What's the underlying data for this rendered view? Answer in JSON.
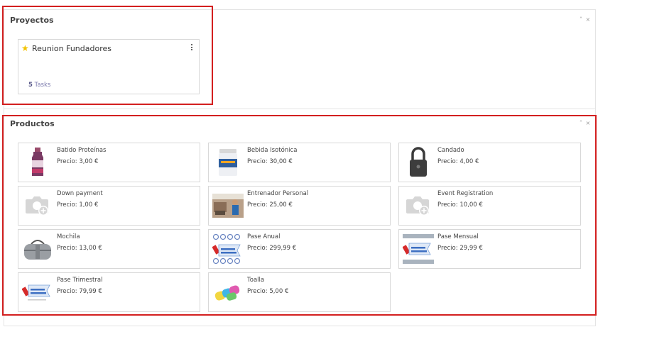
{
  "proyectos": {
    "title": "Proyectos",
    "controls": "˄ ×",
    "card": {
      "name": "Reunion Fundadores",
      "task_count": "5",
      "tasks_label": "Tasks"
    }
  },
  "productos": {
    "title": "Productos",
    "controls": "˄ ×",
    "items": [
      {
        "name": "Batido Proteínas",
        "price": "Precio: 3,00 €",
        "image": "protein-shake-bottle"
      },
      {
        "name": "Bebida Isotónica",
        "price": "Precio: 30,00 €",
        "image": "isotonic-drink-tub"
      },
      {
        "name": "Candado",
        "price": "Precio: 4,00 €",
        "image": "padlock"
      },
      {
        "name": "Down payment",
        "price": "Precio: 1,00 €",
        "image": "camera-placeholder"
      },
      {
        "name": "Entrenador Personal",
        "price": "Precio: 25,00 €",
        "image": "gym-trainer-photo"
      },
      {
        "name": "Event Registration",
        "price": "Precio: 10,00 €",
        "image": "camera-placeholder"
      },
      {
        "name": "Mochila",
        "price": "Precio: 13,00 €",
        "image": "gym-bag"
      },
      {
        "name": "Pase Anual",
        "price": "Precio: 299,99 €",
        "image": "abono-ticket"
      },
      {
        "name": "Pase Mensual",
        "price": "Precio: 29,99 €",
        "image": "abono-ticket"
      },
      {
        "name": "Pase Trimestral",
        "price": "Precio: 79,99 €",
        "image": "abono-ticket"
      },
      {
        "name": "Toalla",
        "price": "Precio: 5,00 €",
        "image": "towels"
      }
    ]
  },
  "colors": {
    "highlight": "#d31f1f",
    "star": "#f3c300",
    "task_link": "#7c7bad"
  }
}
